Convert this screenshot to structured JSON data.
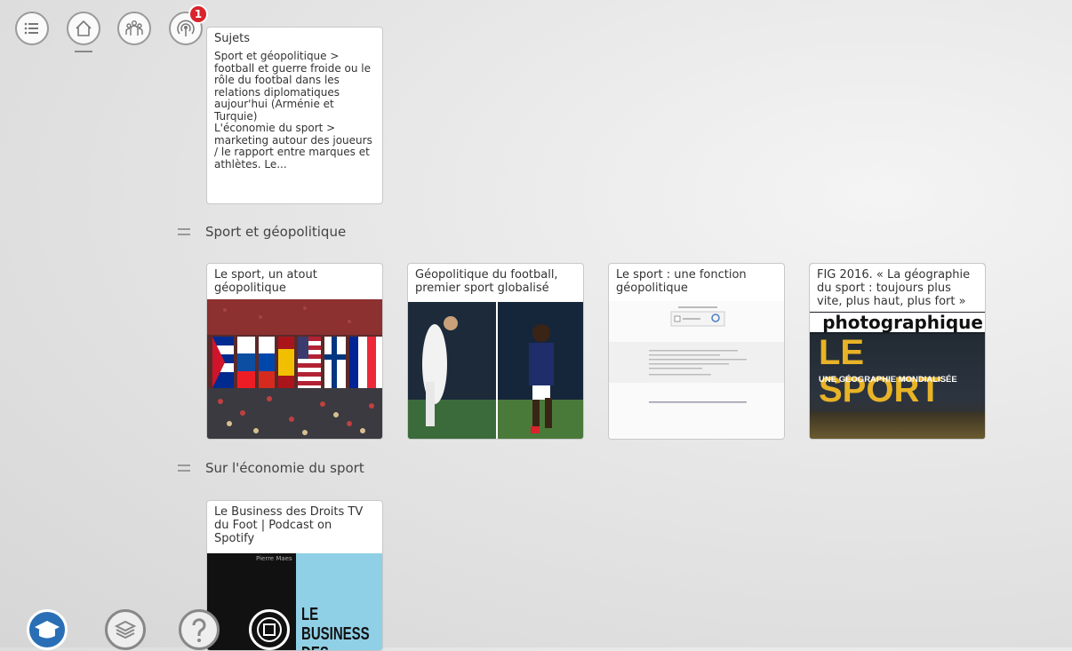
{
  "toolbar": {
    "notifications_count": "1"
  },
  "cards": {
    "sujets": {
      "title": "Sujets",
      "body": "Sport et géopolitique > football et guerre froide ou le rôle du footbal dans les relations diplomatiques aujour'hui (Arménie et Turquie)\nL'économie du sport > marketing autour des joueurs / le rapport entre marques et athlètes. Le..."
    },
    "geo": [
      {
        "title": "Le sport, un atout géopolitique"
      },
      {
        "title": "Géopolitique du football, premier sport globalisé"
      },
      {
        "title": "Le sport : une fonction géopolitique"
      },
      {
        "title": "FIG 2016. « La géographie du sport : toujours plus vite, plus haut, plus fort »",
        "img_text_top": "photographique",
        "img_text_main": "LE SPORT",
        "img_text_sub": "UNE GÉOGRAPHIE MONDIALISÉE"
      }
    ],
    "eco": [
      {
        "title": "Le Business des Droits TV du Foot | Podcast on Spotify",
        "img_author": "Pierre Maes",
        "img_text": "LE BUSINESS DES"
      }
    ]
  },
  "sections": {
    "geo_label": "Sport et géopolitique",
    "eco_label": "Sur l'économie du sport"
  },
  "colors": {
    "badge": "#d9232d",
    "accent_blue": "#2a6fb5"
  }
}
